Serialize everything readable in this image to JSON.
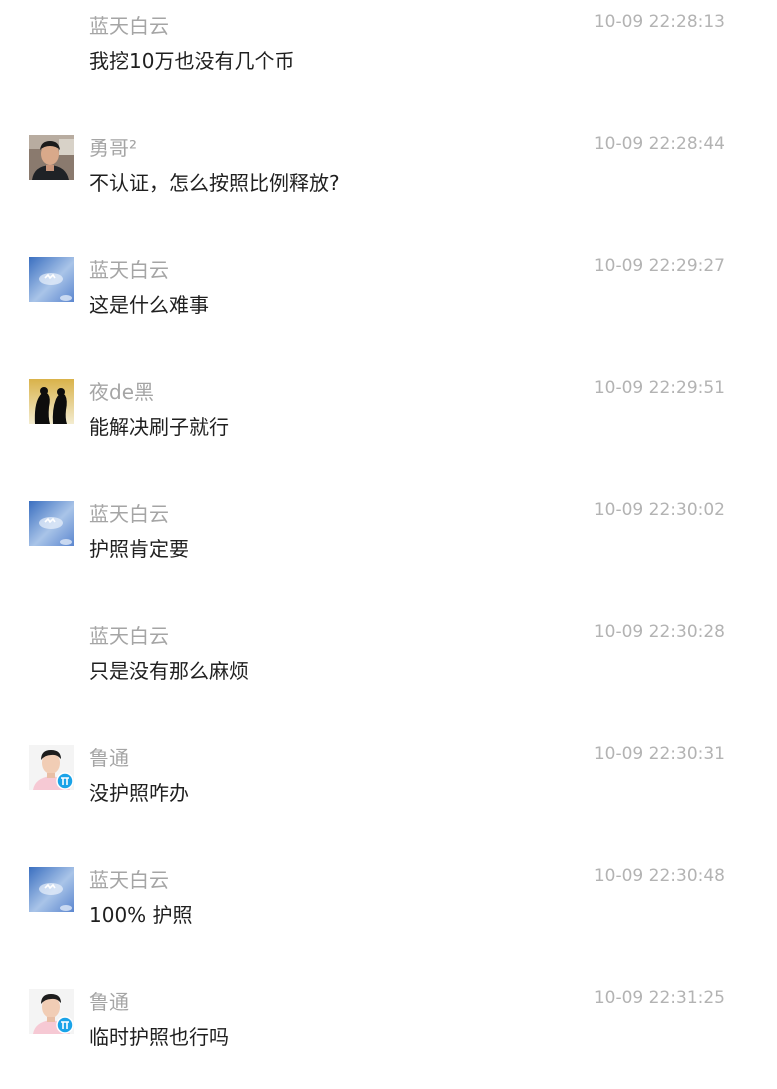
{
  "messages": [
    {
      "name": "蓝天白云",
      "time": "10-09 22:28:13",
      "text": "我挖10万也没有几个币",
      "avatar": "none"
    },
    {
      "name": "勇哥²",
      "time": "10-09 22:28:44",
      "text": "不认证，怎么按照比例释放?",
      "avatar": "man-dark-shirt-avatar"
    },
    {
      "name": "蓝天白云",
      "time": "10-09 22:29:27",
      "text": "这是什么难事",
      "avatar": "blue-sky-avatar"
    },
    {
      "name": "夜de黑",
      "time": "10-09 22:29:51",
      "text": "能解决刷子就行",
      "avatar": "silhouette-couple-avatar"
    },
    {
      "name": "蓝天白云",
      "time": "10-09 22:30:02",
      "text": "护照肯定要",
      "avatar": "blue-sky-avatar"
    },
    {
      "name": "蓝天白云",
      "time": "10-09 22:30:28",
      "text": "只是没有那么麻烦",
      "avatar": "none"
    },
    {
      "name": "鲁通",
      "time": "10-09 22:30:31",
      "text": "没护照咋办",
      "avatar": "man-portrait-pi-badge-avatar"
    },
    {
      "name": "蓝天白云",
      "time": "10-09 22:30:48",
      "text": "100% 护照",
      "avatar": "blue-sky-avatar"
    },
    {
      "name": "鲁通",
      "time": "10-09 22:31:25",
      "text": "临时护照也行吗",
      "avatar": "man-portrait-pi-badge-avatar"
    }
  ],
  "colors": {
    "name": "#a5a5a5",
    "time": "#b3b3b3",
    "text": "#1f1f1f",
    "pi_badge": "#1aa3e8"
  }
}
